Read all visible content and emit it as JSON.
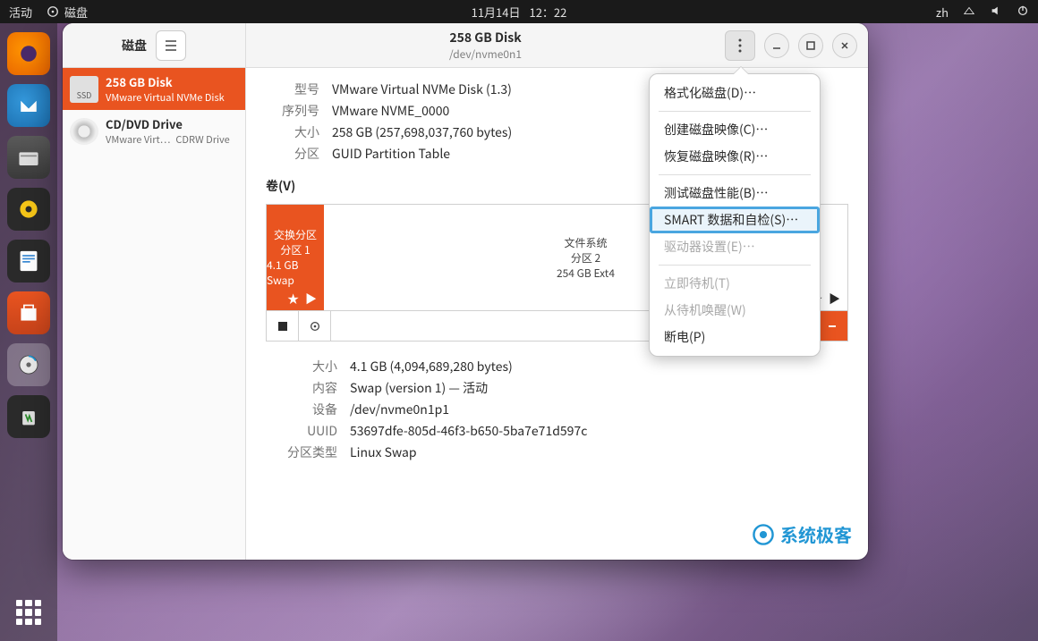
{
  "topbar": {
    "activities": "活动",
    "app_indicator": "磁盘",
    "date": "11月14日",
    "time": "12：22",
    "input": "zh"
  },
  "dock": {
    "items": [
      "firefox",
      "thunderbird",
      "files",
      "music",
      "office",
      "software",
      "disks",
      "trash"
    ]
  },
  "window": {
    "sidebar_title": "磁盘",
    "title": "258 GB Disk",
    "subtitle": "/dev/nvme0n1"
  },
  "sidebar_disks": [
    {
      "name": "258 GB Disk",
      "sub": "VMware Virtual NVMe Disk",
      "icon": "SSD",
      "selected": true
    },
    {
      "name": "CD/DVD Drive",
      "sub1": "VMware Virt…",
      "sub2": "CDRW Drive",
      "icon": "cd",
      "selected": false
    }
  ],
  "disk_info_labels": {
    "model": "型号",
    "serial": "序列号",
    "size": "大小",
    "part": "分区"
  },
  "disk_info": {
    "model": "VMware Virtual NVMe Disk (1.3)",
    "serial": "VMware NVME_0000",
    "size": "258 GB (257,698,037,760 bytes)",
    "part": "GUID Partition Table"
  },
  "volumes_heading": "卷(V)",
  "partitions": {
    "swap": {
      "l1": "交换分区",
      "l2": "分区 1",
      "l3": "4.1 GB Swap"
    },
    "fs": {
      "l1": "文件系统",
      "l2": "分区 2",
      "l3": "254 GB Ext4"
    }
  },
  "vol_detail_labels": {
    "size": "大小",
    "content": "内容",
    "device": "设备",
    "uuid": "UUID",
    "ptype": "分区类型"
  },
  "vol_detail": {
    "size": "4.1 GB (4,094,689,280 bytes)",
    "content": "Swap (version 1) — 活动",
    "device": "/dev/nvme0n1p1",
    "uuid": "53697dfe-805d-46f3-b650-5ba7e71d597c",
    "ptype": "Linux Swap"
  },
  "watermark": "系统极客",
  "menu": {
    "format": "格式化磁盘(D)…",
    "create_image": "创建磁盘映像(C)…",
    "restore_image": "恢复磁盘映像(R)…",
    "benchmark": "测试磁盘性能(B)…",
    "smart": "SMART 数据和自检(S)…",
    "drive_settings": "驱动器设置(E)…",
    "standby": "立即待机(T)",
    "wake": "从待机唤醒(W)",
    "poweroff": "断电(P)"
  }
}
